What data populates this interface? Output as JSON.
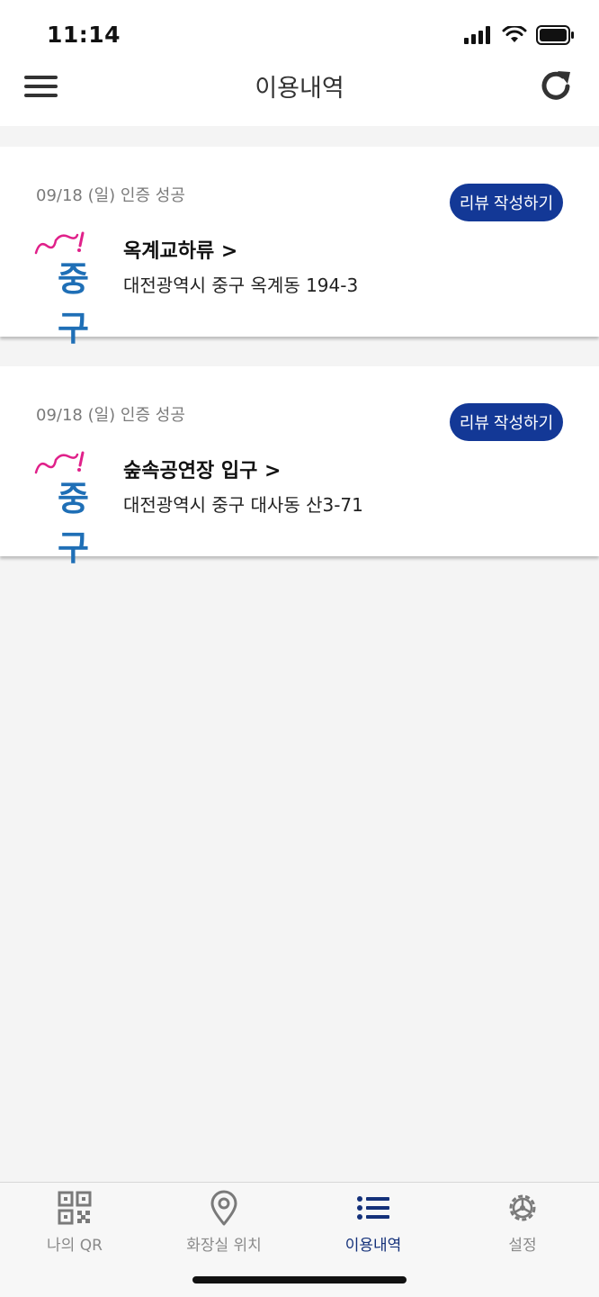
{
  "status": {
    "time": "11:14"
  },
  "header": {
    "title": "이용내역",
    "menu_icon": "hamburger-icon",
    "refresh_icon": "refresh-icon"
  },
  "records": [
    {
      "date": "09/18 (일) 인증 성공",
      "review_label": "리뷰 작성하기",
      "name": "옥계교하류 >",
      "address": "대전광역시 중구 옥계동 194-3",
      "logo_text": "중구"
    },
    {
      "date": "09/18 (일) 인증 성공",
      "review_label": "리뷰 작성하기",
      "name": "숲속공연장 입구 >",
      "address": "대전광역시 중구 대사동 산3-71",
      "logo_text": "중구"
    }
  ],
  "tabs": [
    {
      "label": "나의 QR",
      "icon": "qr-code-icon",
      "active": false
    },
    {
      "label": "화장실 위치",
      "icon": "location-pin-icon",
      "active": false
    },
    {
      "label": "이용내역",
      "icon": "list-icon",
      "active": true
    },
    {
      "label": "설정",
      "icon": "gear-icon",
      "active": false
    }
  ],
  "colors": {
    "accent": "#133896",
    "active_tab": "#14317a",
    "logo_blue": "#1f6fb6",
    "logo_pink": "#e0218a"
  }
}
